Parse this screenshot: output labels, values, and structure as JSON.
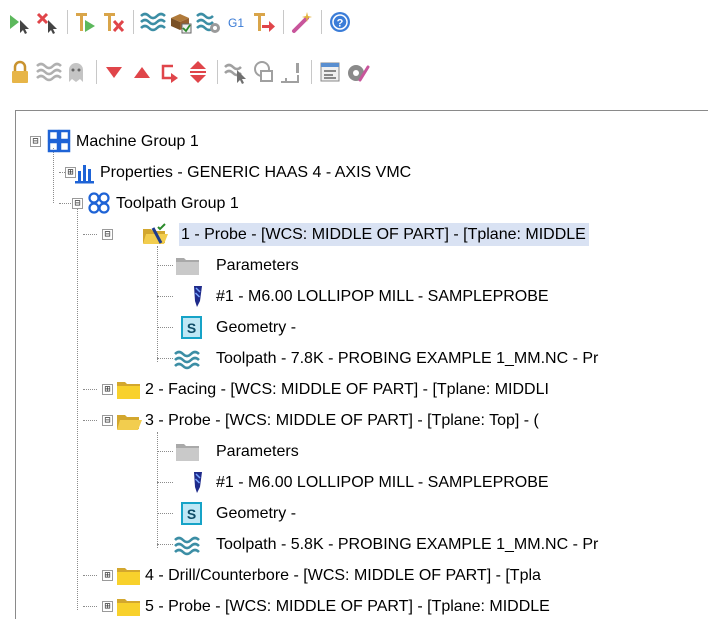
{
  "toolbar_row1": [
    {
      "id": "select-all-operations",
      "icon": "arrow-cursor-play-icon"
    },
    {
      "id": "select-all-dirty",
      "icon": "arrow-cursor-x-icon"
    },
    {
      "id": "regenerate-selected",
      "icon": "play-flag-icon"
    },
    {
      "id": "regenerate-dirty",
      "icon": "x-flag-icon"
    },
    {
      "id": "backplot",
      "icon": "wave-lines-icon"
    },
    {
      "id": "verify",
      "icon": "block-check-icon"
    },
    {
      "id": "simulate",
      "icon": "wave-gear-icon"
    },
    {
      "id": "post-selected",
      "icon": "g1-icon"
    },
    {
      "id": "post-to-file",
      "icon": "flag-arrow-icon"
    },
    {
      "id": "toolpath-manager-wand",
      "icon": "magic-wand-icon"
    },
    {
      "id": "help",
      "icon": "help-circle-icon"
    }
  ],
  "toolbar_row2": [
    {
      "id": "lock",
      "icon": "lock-icon"
    },
    {
      "id": "toggle-display",
      "icon": "wave-toggle-icon"
    },
    {
      "id": "toggle-posting",
      "icon": "ghost-icon"
    },
    {
      "id": "move-down",
      "icon": "triangle-down-icon"
    },
    {
      "id": "move-up",
      "icon": "triangle-up-icon"
    },
    {
      "id": "insert-arrow",
      "icon": "insert-arrow-icon"
    },
    {
      "id": "scroll-to-insert",
      "icon": "up-down-arrow-icon"
    },
    {
      "id": "show-selected",
      "icon": "wave-cursor-icon"
    },
    {
      "id": "solid-toggle",
      "icon": "box-toggle-icon"
    },
    {
      "id": "stock-model",
      "icon": "stock-model-icon"
    },
    {
      "id": "setup-sheet",
      "icon": "setup-sheet-icon"
    },
    {
      "id": "tool-edit",
      "icon": "tool-eye-icon"
    }
  ],
  "tree": [
    {
      "label": "Machine Group 1",
      "icon": "machine-group-icon",
      "expander": "⊟"
    },
    {
      "label": "Properties - GENERIC HAAS 4 - AXIS VMC",
      "icon": "properties-bars-icon",
      "expander": "⊞"
    },
    {
      "label": "Toolpath Group 1",
      "icon": "toolpath-group-icon",
      "expander": "⊟"
    },
    {
      "label": "1 - Probe - [WCS: MIDDLE OF PART] - [Tplane: MIDDLE",
      "icon": "open-folder-check-icon",
      "expander": "⊟",
      "selected": true
    },
    {
      "label": "Parameters",
      "icon": "parameters-folder-icon"
    },
    {
      "label": "#1 - M6.00 LOLLIPOP MILL - SAMPLEPROBE",
      "icon": "tool-icon"
    },
    {
      "label": "Geometry -",
      "icon": "geometry-icon"
    },
    {
      "label": "Toolpath - 7.8K - PROBING EXAMPLE 1_MM.NC - Pr",
      "icon": "toolpath-wave-icon"
    },
    {
      "label": "2 - Facing - [WCS: MIDDLE OF PART] - [Tplane: MIDDLI",
      "icon": "closed-folder-icon",
      "expander": "⊞"
    },
    {
      "label": "3 - Probe - [WCS: MIDDLE OF PART] - [Tplane: Top] - (",
      "icon": "open-folder-icon",
      "expander": "⊟"
    },
    {
      "label": "Parameters",
      "icon": "parameters-folder-icon"
    },
    {
      "label": "#1 - M6.00 LOLLIPOP MILL - SAMPLEPROBE",
      "icon": "tool-icon"
    },
    {
      "label": "Geometry -",
      "icon": "geometry-icon"
    },
    {
      "label": "Toolpath - 5.8K - PROBING EXAMPLE 1_MM.NC - Pr",
      "icon": "toolpath-wave-icon"
    },
    {
      "label": "4 - Drill/Counterbore - [WCS: MIDDLE OF PART] - [Tpla",
      "icon": "closed-folder-icon",
      "expander": "⊞"
    },
    {
      "label": "5 - Probe - [WCS: MIDDLE OF PART] - [Tplane: MIDDLE",
      "icon": "closed-folder-icon",
      "expander": "⊞"
    }
  ]
}
